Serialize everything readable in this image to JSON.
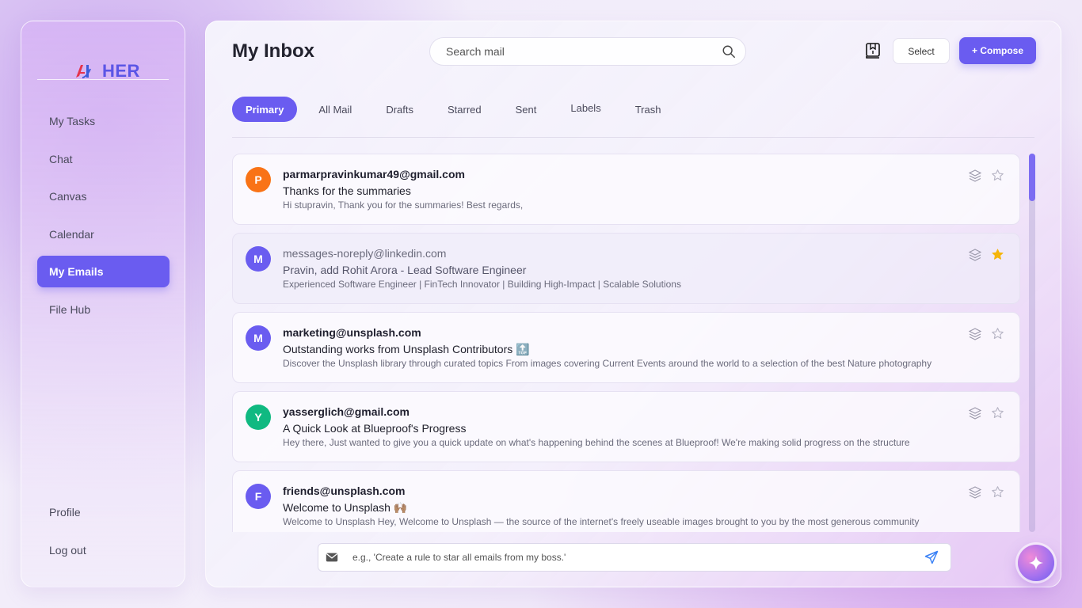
{
  "brand": {
    "name": "HER",
    "logo_text": "AI"
  },
  "sidebar": {
    "items": [
      {
        "label": "My Tasks"
      },
      {
        "label": "Chat"
      },
      {
        "label": "Canvas"
      },
      {
        "label": "Calendar"
      },
      {
        "label": "My Emails",
        "active": true
      },
      {
        "label": "File Hub"
      }
    ],
    "bottom_items": [
      {
        "label": "Profile"
      },
      {
        "label": "Log out"
      }
    ]
  },
  "header": {
    "title": "My Inbox",
    "search_placeholder": "Search mail",
    "select_label": "Select",
    "compose_label": "+ Compose"
  },
  "tabs": [
    {
      "label": "Primary",
      "active": true
    },
    {
      "label": "All Mail"
    },
    {
      "label": "Drafts"
    },
    {
      "label": "Starred"
    },
    {
      "label": "Sent"
    },
    {
      "label": "Labels"
    },
    {
      "label": "Trash"
    }
  ],
  "emails": [
    {
      "avatar": "P",
      "avatar_color": "#f97316",
      "sender": "parmarpravinkumar49@gmail.com",
      "subject": "Thanks for the summaries",
      "preview": "Hi stupravin, Thank you for the summaries! Best regards,",
      "starred": false,
      "read": false
    },
    {
      "avatar": "M",
      "avatar_color": "#6a5cf0",
      "sender": "messages-noreply@linkedin.com",
      "subject": "Pravin, add Rohit Arora - Lead Software Engineer",
      "preview": "Experienced Software Engineer | FinTech Innovator | Building High-Impact | Scalable Solutions",
      "starred": true,
      "read": true
    },
    {
      "avatar": "M",
      "avatar_color": "#6a5cf0",
      "sender": "marketing@unsplash.com",
      "subject": "Outstanding works from Unsplash Contributors 🔝",
      "preview": "Discover the Unsplash library through curated topics From images covering Current Events around the world to a selection of the best Nature photography",
      "starred": false,
      "read": false
    },
    {
      "avatar": "Y",
      "avatar_color": "#10b981",
      "sender": "yasserglich@gmail.com",
      "subject": "A Quick Look at Blueproof's Progress",
      "preview": "Hey there, Just wanted to give you a quick update on what's happening behind the scenes at Blueproof! We're making solid progress on the structure",
      "starred": false,
      "read": false
    },
    {
      "avatar": "F",
      "avatar_color": "#6a5cf0",
      "sender": "friends@unsplash.com",
      "subject": "Welcome to Unsplash 🙌🏽",
      "preview": "Welcome to Unsplash Hey, Welcome to Unsplash — the source of the internet's freely useable images brought to you by the most generous community",
      "starred": false,
      "read": false
    }
  ],
  "ai_bar": {
    "placeholder": "e.g., 'Create a rule to star all emails from my boss.'"
  },
  "colors": {
    "accent": "#6a5cf0",
    "star_active": "#f5b50a",
    "star_inactive": "#b8b6c6"
  }
}
